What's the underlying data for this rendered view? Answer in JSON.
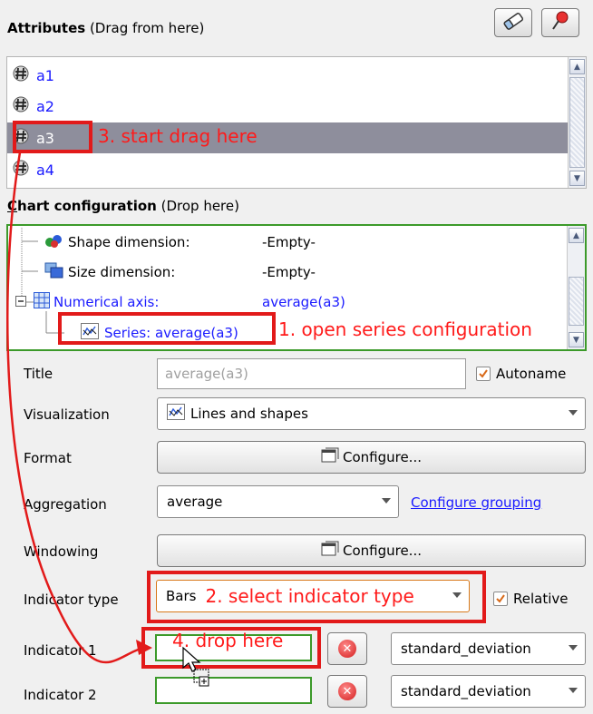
{
  "attributes": {
    "title": "Attributes",
    "hint": " (Drag from here)",
    "items": [
      {
        "label": "a1"
      },
      {
        "label": "a2"
      },
      {
        "label": "a3"
      },
      {
        "label": "a4"
      }
    ],
    "icons": [
      "eraser-icon",
      "pin-icon"
    ]
  },
  "chart_config": {
    "title_prefix": "C",
    "title_rest": "hart configuration",
    "hint": " (Drop here)",
    "rows": [
      {
        "label": "Shape dimension:",
        "value": "-Empty-"
      },
      {
        "label": "Size dimension:",
        "value": "-Empty-"
      },
      {
        "label": "Numerical axis:",
        "value": "average(a3)"
      },
      {
        "label": "Series: average(a3)"
      }
    ]
  },
  "form": {
    "title_label": "Title",
    "title_placeholder": "average(a3)",
    "autoname_label": "Autoname",
    "visualization_label": "Visualization",
    "visualization_value": "Lines and shapes",
    "format_label": "Format",
    "configure_label": "Configure...",
    "aggregation_label": "Aggregation",
    "aggregation_value": "average",
    "configure_grouping": "Configure grouping",
    "windowing_label": "Windowing",
    "indicator_type_label": "Indicator type",
    "indicator_type_value": "Bars",
    "relative_label": "Relative",
    "indicator1_label": "Indicator 1",
    "indicator2_label": "Indicator 2",
    "indicator1_func": "standard_deviation",
    "indicator2_func": "standard_deviation"
  },
  "annotations": {
    "step1": "1. open series configuration",
    "step2": "2. select indicator type",
    "step3": "3. start drag here",
    "step4": "4. drop here"
  },
  "colors": {
    "accent_red": "#e21a1a",
    "link_blue": "#1a1aff",
    "drop_green": "#3c9a2a",
    "selection": "#8e8e9c"
  }
}
